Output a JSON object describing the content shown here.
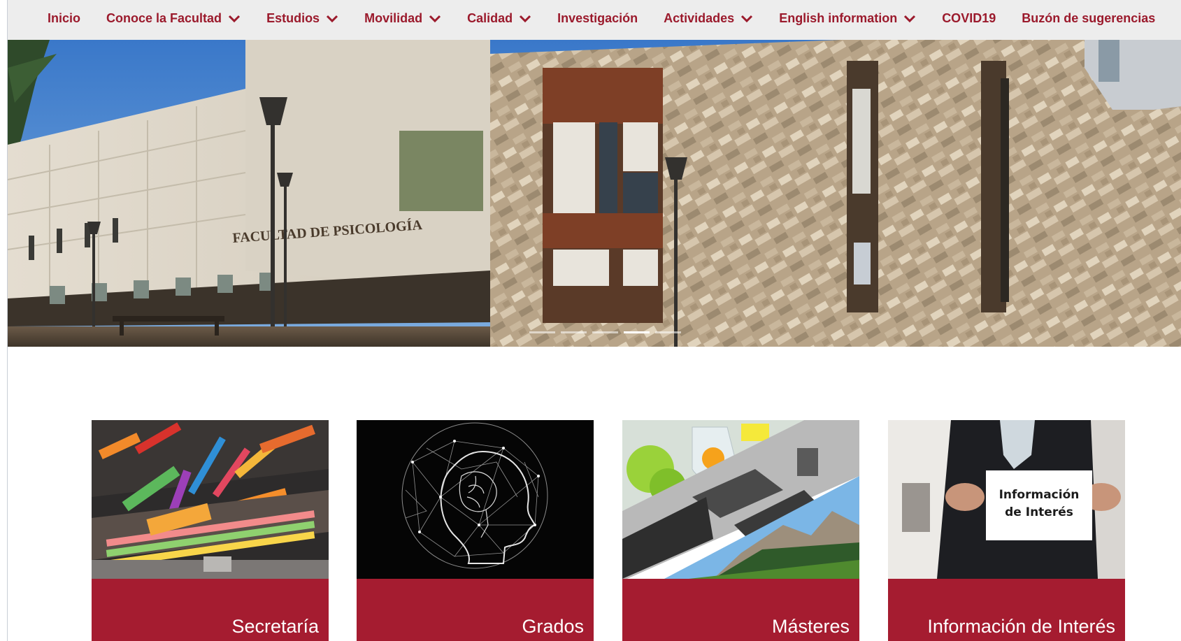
{
  "nav": {
    "items": [
      {
        "label": "Inicio",
        "has_dropdown": false
      },
      {
        "label": "Conoce la Facultad",
        "has_dropdown": true
      },
      {
        "label": "Estudios",
        "has_dropdown": true
      },
      {
        "label": "Movilidad",
        "has_dropdown": true
      },
      {
        "label": "Calidad",
        "has_dropdown": true
      },
      {
        "label": "Investigación",
        "has_dropdown": false
      },
      {
        "label": "Actividades",
        "has_dropdown": true
      },
      {
        "label": "English information",
        "has_dropdown": true
      },
      {
        "label": "COVID19",
        "has_dropdown": false
      },
      {
        "label": "Buzón de sugerencias",
        "has_dropdown": false
      }
    ]
  },
  "hero": {
    "sign_text": "FACULTAD DE PSICOLOGÍA",
    "slide_count": 5,
    "active_slide": 4
  },
  "cards": [
    {
      "title": "Secretaría",
      "icon": "art-supplies-image"
    },
    {
      "title": "Grados",
      "icon": "brain-network-image"
    },
    {
      "title": "Másteres",
      "icon": "lab-landscape-collage-image"
    },
    {
      "title": "Información de Interés",
      "icon": "info-sign-image",
      "sign_text": [
        "Información",
        "de Interés"
      ]
    }
  ],
  "colors": {
    "brand_red": "#a51c30",
    "nav_text": "#9b1a2c",
    "nav_bg": "#ededed"
  }
}
